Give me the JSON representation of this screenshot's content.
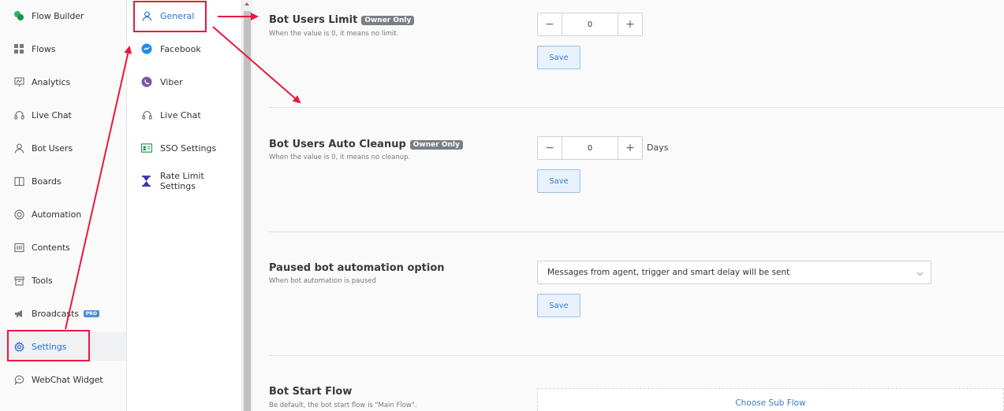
{
  "sidebar": {
    "items": [
      {
        "label": "Flow Builder",
        "icon": "flow-builder-icon"
      },
      {
        "label": "Flows",
        "icon": "grid-icon"
      },
      {
        "label": "Analytics",
        "icon": "analytics-icon"
      },
      {
        "label": "Live Chat",
        "icon": "headset-icon"
      },
      {
        "label": "Bot Users",
        "icon": "user-icon"
      },
      {
        "label": "Boards",
        "icon": "board-icon"
      },
      {
        "label": "Automation",
        "icon": "automation-icon"
      },
      {
        "label": "Contents",
        "icon": "contents-icon"
      },
      {
        "label": "Tools",
        "icon": "tools-icon"
      },
      {
        "label": "Broadcasts",
        "icon": "megaphone-icon",
        "badge": "PRO"
      },
      {
        "label": "Settings",
        "icon": "gear-icon"
      },
      {
        "label": "WebChat Widget",
        "icon": "chat-bubble-icon"
      }
    ],
    "active": "Settings"
  },
  "subnav": {
    "items": [
      {
        "label": "General",
        "icon": "user-icon"
      },
      {
        "label": "Facebook",
        "icon": "messenger-icon"
      },
      {
        "label": "Viber",
        "icon": "viber-icon"
      },
      {
        "label": "Live Chat",
        "icon": "headset-icon"
      },
      {
        "label": "SSO Settings",
        "icon": "id-card-icon"
      },
      {
        "label": "Rate Limit Settings",
        "icon": "hourglass-icon"
      }
    ],
    "active": "General"
  },
  "sections": {
    "bot_users_limit": {
      "title": "Bot Users Limit",
      "badge": "Owner Only",
      "desc": "When the value is 0, it means no limit.",
      "minus": "−",
      "value": "0",
      "plus": "+",
      "save": "Save"
    },
    "auto_cleanup": {
      "title": "Bot Users Auto Cleanup",
      "badge": "Owner Only",
      "desc": "When the value is 0, it means no cleanup.",
      "minus": "−",
      "value": "0",
      "plus": "+",
      "unit": "Days",
      "save": "Save"
    },
    "paused_option": {
      "title": "Paused bot automation option",
      "desc": "When bot automation is paused",
      "selected": "Messages from agent, trigger and smart delay will be sent",
      "save": "Save"
    },
    "start_flow": {
      "title": "Bot Start Flow",
      "desc": "Be default, the bot start flow is \"Main Flow\".",
      "choose": "Choose Sub Flow"
    }
  },
  "colors": {
    "accent": "#2d6fd6",
    "annotation": "#e8193c"
  }
}
